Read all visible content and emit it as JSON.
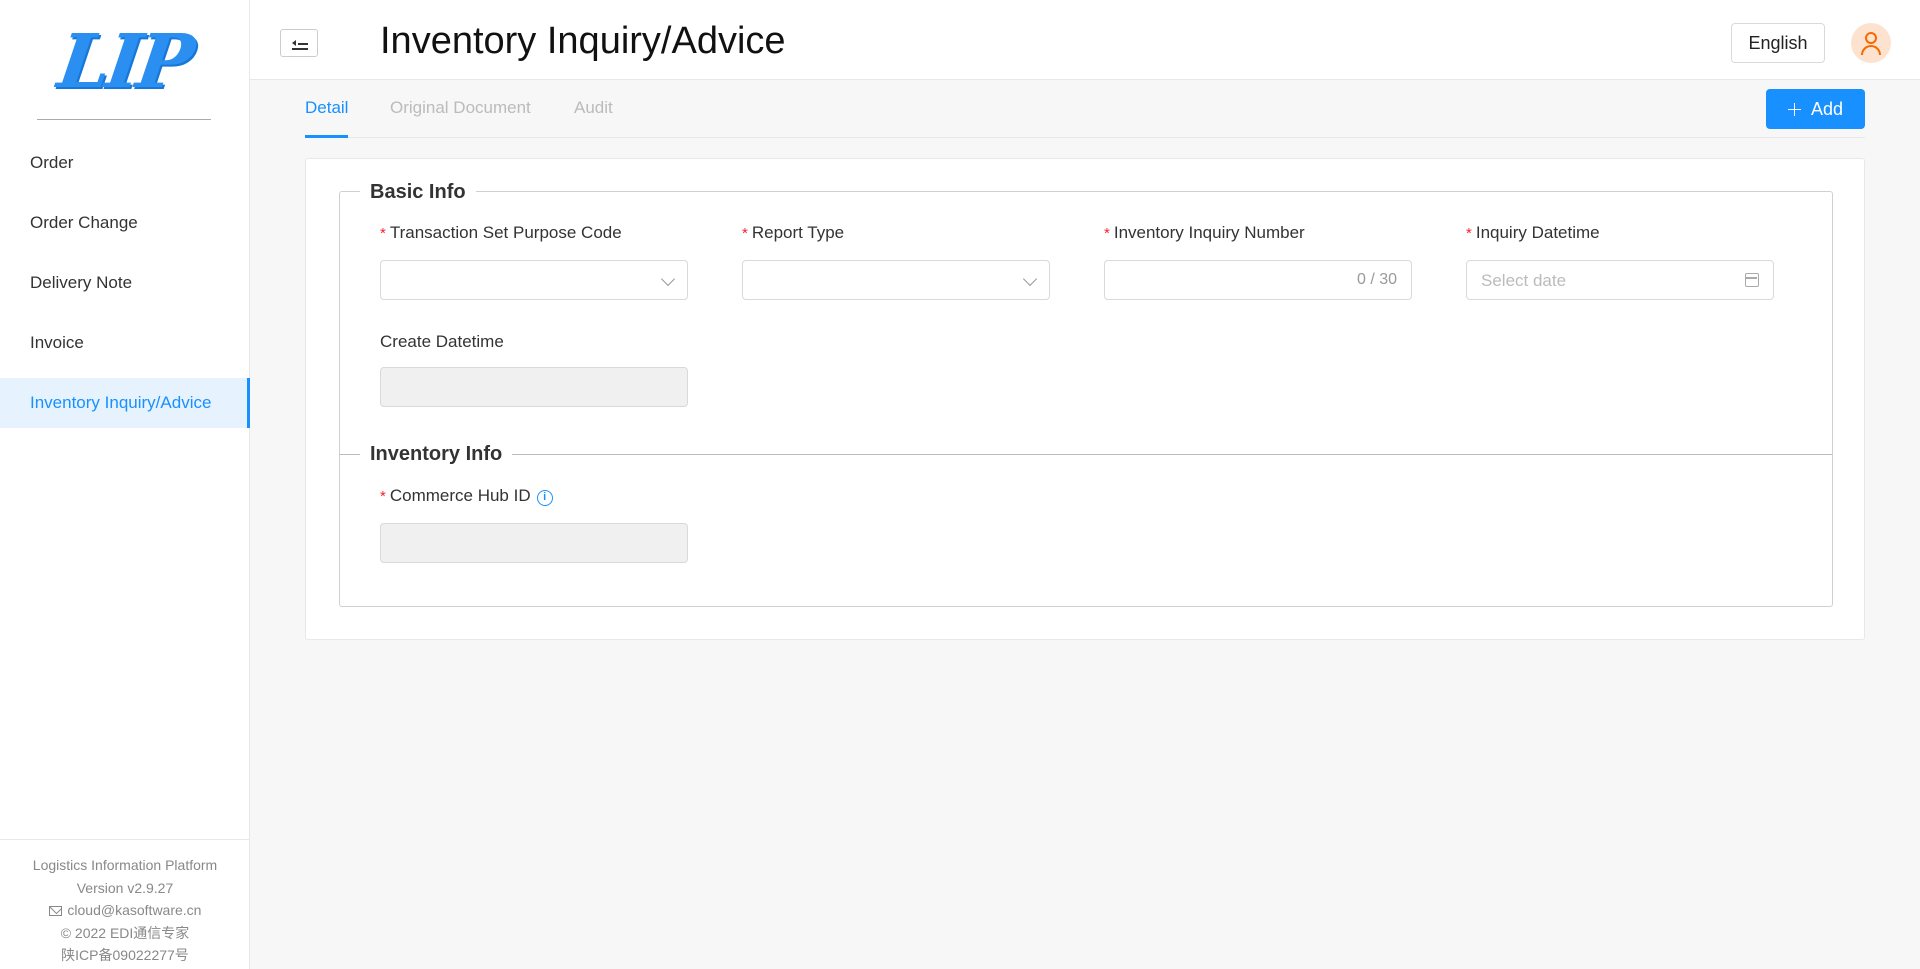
{
  "app": {
    "logo_text": "LIP",
    "page_title": "Inventory Inquiry/Advice"
  },
  "sidebar": {
    "items": [
      {
        "label": "Order"
      },
      {
        "label": "Order Change"
      },
      {
        "label": "Delivery Note"
      },
      {
        "label": "Invoice"
      },
      {
        "label": "Inventory Inquiry/Advice",
        "active": true
      }
    ],
    "footer": {
      "platform": "Logistics Information Platform",
      "version": "Version v2.9.27",
      "email": "cloud@kasoftware.cn",
      "copyright": "© 2022 EDI通信专家",
      "icp": "陕ICP备09022277号"
    }
  },
  "header": {
    "language": "English"
  },
  "tabs": [
    {
      "label": "Detail",
      "active": true
    },
    {
      "label": "Original Document"
    },
    {
      "label": "Audit"
    }
  ],
  "toolbar": {
    "add_label": "Add"
  },
  "basic_info": {
    "title": "Basic Info",
    "fields": {
      "purpose_code": {
        "label": "Transaction Set Purpose Code",
        "required": true,
        "value": ""
      },
      "report_type": {
        "label": "Report Type",
        "required": true,
        "value": ""
      },
      "inquiry_number": {
        "label": "Inventory Inquiry Number",
        "required": true,
        "value": "",
        "counter": "0 / 30"
      },
      "inquiry_datetime": {
        "label": "Inquiry Datetime",
        "required": true,
        "placeholder": "Select date"
      },
      "create_datetime": {
        "label": "Create Datetime",
        "required": false,
        "value": ""
      }
    }
  },
  "inventory_info": {
    "title": "Inventory Info",
    "fields": {
      "commerce_hub_id": {
        "label": "Commerce Hub ID",
        "required": true,
        "value": ""
      }
    }
  },
  "colors": {
    "primary": "#1890ff",
    "required": "#f5222d",
    "avatar_bg": "#fde3cf",
    "avatar_fg": "#f56a00"
  }
}
